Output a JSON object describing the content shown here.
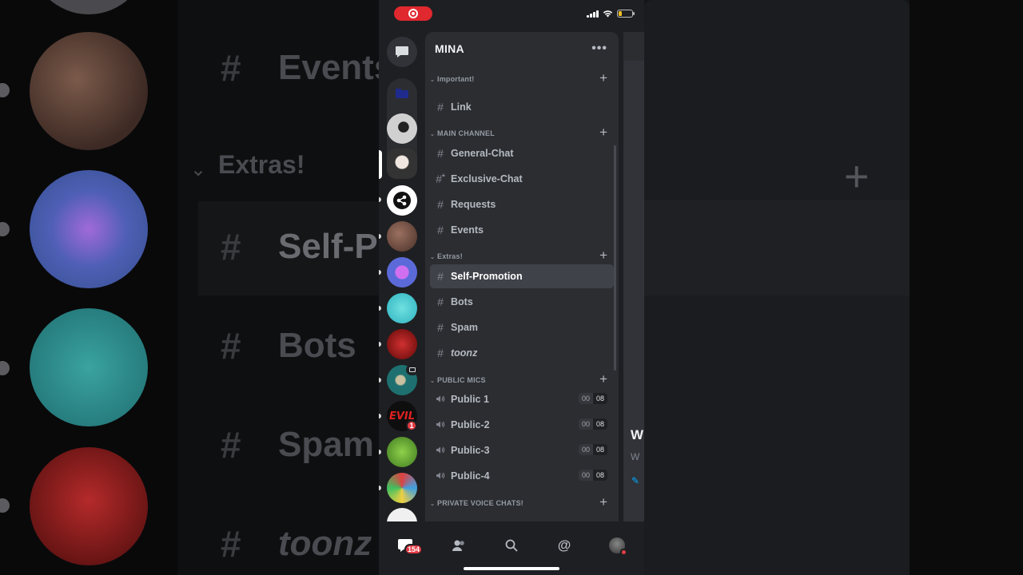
{
  "status_bar": {
    "recording": true
  },
  "server": {
    "name": "MINA"
  },
  "categories": [
    {
      "label": "Important!",
      "channels": [
        {
          "name": "Link",
          "icon": "hash-icon"
        }
      ]
    },
    {
      "label": "MAIN CHANNEL",
      "channels": [
        {
          "name": "General-Chat",
          "icon": "hash-icon"
        },
        {
          "name": "Exclusive-Chat",
          "icon": "locked-hash-icon"
        },
        {
          "name": "Requests",
          "icon": "hash-icon"
        },
        {
          "name": "Events",
          "icon": "hash-icon"
        }
      ]
    },
    {
      "label": "Extras!",
      "channels": [
        {
          "name": "Self-Promotion",
          "icon": "hash-icon",
          "selected": true
        },
        {
          "name": "Bots",
          "icon": "hash-icon"
        },
        {
          "name": "Spam",
          "icon": "hash-icon"
        },
        {
          "name": "toonz",
          "icon": "hash-icon",
          "italic": true
        }
      ]
    },
    {
      "label": "PUBLIC MICS",
      "channels": [
        {
          "name": "Public 1",
          "icon": "speaker-icon",
          "users": "00",
          "limit": "08"
        },
        {
          "name": "Public-2",
          "icon": "speaker-icon",
          "users": "00",
          "limit": "08"
        },
        {
          "name": "Public-3",
          "icon": "speaker-icon",
          "users": "00",
          "limit": "08"
        },
        {
          "name": "Public-4",
          "icon": "speaker-icon",
          "users": "00",
          "limit": "08"
        }
      ]
    },
    {
      "label": "PRIVATE VOICE CHATS!",
      "channels": []
    }
  ],
  "rail": {
    "mentions_badge": "1"
  },
  "tabbar": {
    "home_badge": "154"
  },
  "background": {
    "left_labels": [
      "Events",
      "Extras!",
      "Self-P",
      "Bots",
      "Spam",
      "toonz"
    ]
  },
  "peek": {
    "title": "W",
    "subtitle": "W"
  },
  "colors": {
    "accent": "#5865f2",
    "danger": "#e23c45",
    "panel": "#2b2d31",
    "rail": "#1e1f22"
  }
}
